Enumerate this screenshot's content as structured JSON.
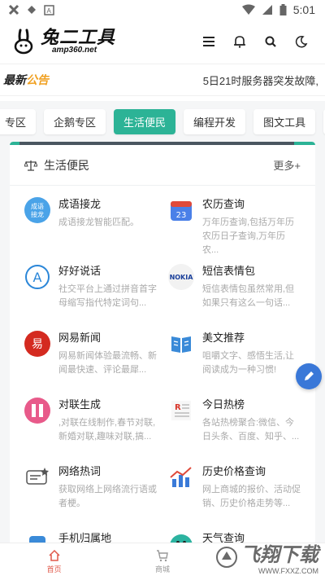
{
  "status_bar": {
    "time": "5:01"
  },
  "header": {
    "logo_cn": "兔二工具",
    "logo_en": "amp360.net",
    "icons": [
      "menu-icon",
      "bell-icon",
      "search-icon",
      "moon-icon"
    ]
  },
  "notice": {
    "badge_part1": "最新",
    "badge_part2": "公告",
    "text": "5日21时服务器突发故障,"
  },
  "tabs": [
    "专区",
    "企鹅专区",
    "生活便民",
    "编程开发",
    "图文工具",
    "文章列"
  ],
  "active_tab": "生活便民",
  "section": {
    "title": "生活便民",
    "more": "更多+",
    "items": [
      {
        "title": "成语接龙",
        "desc": "成语接龙智能匹配。",
        "icon": "idiom-icon",
        "color": "#4aa3e8"
      },
      {
        "title": "农历查询",
        "desc": "万年历查询,包括万年历农历日子查询,万年历农...",
        "icon": "calendar-icon",
        "color": "#4a80e8"
      },
      {
        "title": "好好说话",
        "desc": "社交平台上通过拼音首字母缩写指代特定词句...",
        "icon": "letter-a-icon",
        "color": "#2a86d8"
      },
      {
        "title": "短信表情包",
        "desc": "短信表情包虽然常用,但如果只有这么一句话...",
        "icon": "nokia-icon",
        "color": "#1a3f9a"
      },
      {
        "title": "网易新闻",
        "desc": "网易新闻体验最流畅、新闻最快速、评论最犀...",
        "icon": "netease-icon",
        "color": "#d42a20"
      },
      {
        "title": "美文推荐",
        "desc": "咀嚼文字、感悟生活,让阅读成为一种习惯!",
        "icon": "book-icon",
        "color": "#3a8ad8"
      },
      {
        "title": "对联生成",
        "desc": ",对联在线制作,春节对联,新婚对联,趣味对联,搞...",
        "icon": "couplet-icon",
        "color": "#e85a8a"
      },
      {
        "title": "今日热榜",
        "desc": "各站热榜聚合:微信、今日头条、百度、知乎、...",
        "icon": "hotlist-icon",
        "color": "#d8362a"
      },
      {
        "title": "网络热词",
        "desc": "获取网络上网络流行语或者梗。",
        "icon": "hotword-icon",
        "color": "#555555"
      },
      {
        "title": "历史价格查询",
        "desc": "网上商城的报价、活动促销、历史价格走势等...",
        "icon": "price-chart-icon",
        "color": "#3a7ad8"
      },
      {
        "title": "手机归属地",
        "desc": "",
        "icon": "phone-icon",
        "color": "#3a8ad8"
      },
      {
        "title": "天气查询",
        "desc": "",
        "icon": "weather-icon",
        "color": "#2cb3a0"
      }
    ]
  },
  "bottom_nav": [
    {
      "label": "首页",
      "icon": "home-icon",
      "active": true
    },
    {
      "label": "商城",
      "icon": "cart-icon",
      "active": false
    }
  ],
  "watermark": {
    "text": "飞翔下载",
    "sub": "WWW.FXXZ.COM"
  }
}
